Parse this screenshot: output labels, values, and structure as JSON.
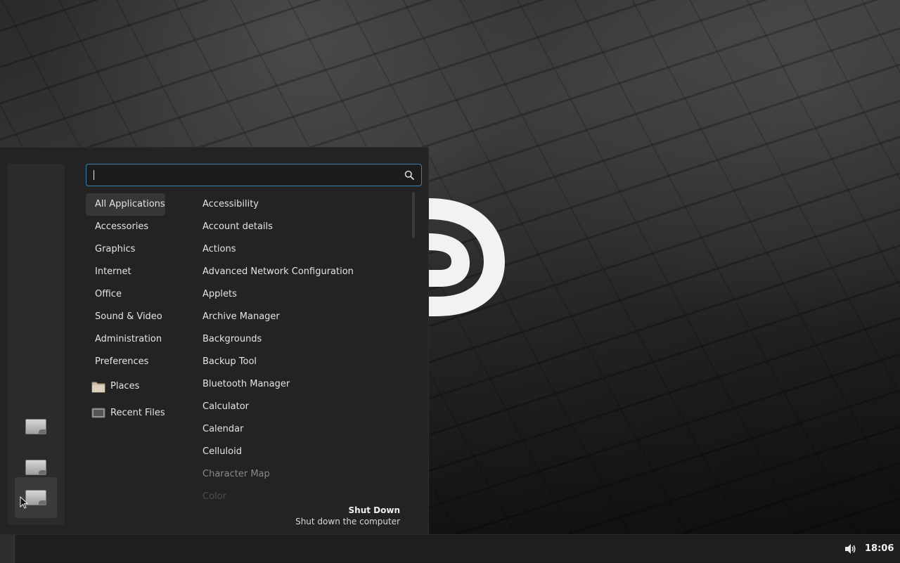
{
  "search": {
    "value": "",
    "placeholder": ""
  },
  "categories": [
    {
      "label": "All Applications",
      "active": true
    },
    {
      "label": "Accessories"
    },
    {
      "label": "Graphics"
    },
    {
      "label": "Internet"
    },
    {
      "label": "Office"
    },
    {
      "label": "Sound & Video"
    },
    {
      "label": "Administration"
    },
    {
      "label": "Preferences"
    },
    {
      "label": "Places",
      "icon": "folder-icon"
    },
    {
      "label": "Recent Files",
      "icon": "recent-files-icon"
    }
  ],
  "apps": [
    "Accessibility",
    "Account details",
    "Actions",
    "Advanced Network Configuration",
    "Applets",
    "Archive Manager",
    "Backgrounds",
    "Backup Tool",
    "Bluetooth Manager",
    "Calculator",
    "Calendar",
    "Celluloid",
    "Character Map",
    "Color"
  ],
  "description": {
    "title": "Shut Down",
    "subtitle": "Shut down the computer"
  },
  "favorites": [
    "lock-screen-icon",
    "logout-icon",
    "shutdown-icon"
  ],
  "panel": {
    "clock": "18:06",
    "volume_icon": "volume-icon"
  },
  "colors": {
    "accent": "#3d7fb1",
    "menu_bg": "#232323",
    "panel_bg": "#1f1f1f"
  }
}
